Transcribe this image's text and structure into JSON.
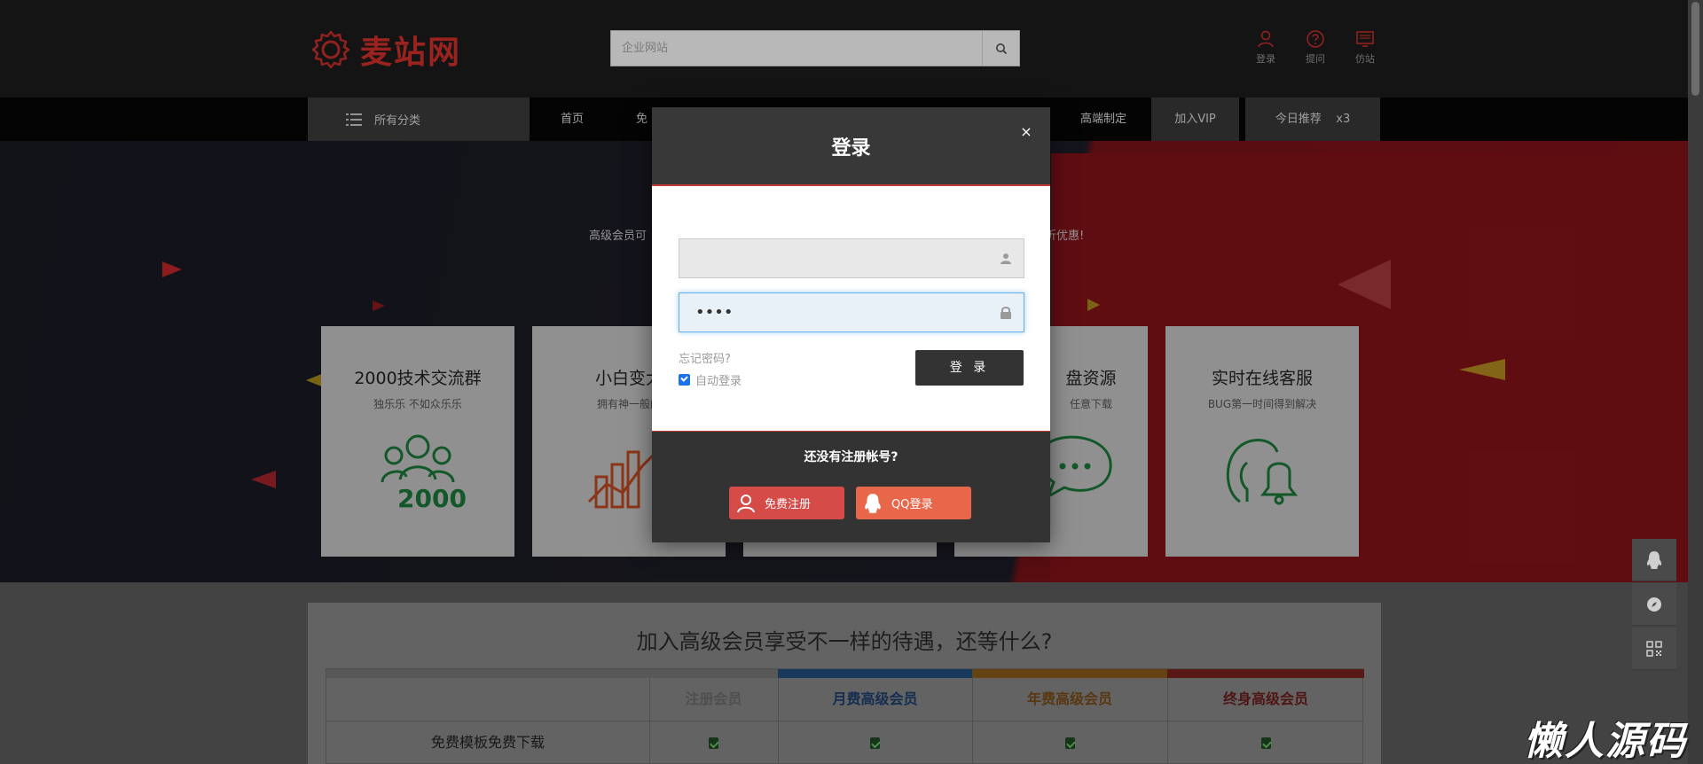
{
  "brand": {
    "name": "麦站网",
    "color": "#d6312d"
  },
  "search": {
    "placeholder": "企业网站"
  },
  "top_links": [
    {
      "label": "登录",
      "icon": "user-icon"
    },
    {
      "label": "提问",
      "icon": "question-icon"
    },
    {
      "label": "仿站",
      "icon": "monitor-icon"
    }
  ],
  "nav": {
    "categories_label": "所有分类",
    "items": [
      "首页",
      "免",
      "高端制定"
    ],
    "vip_label": "加入VIP",
    "today_label": "今日推荐",
    "today_count": "x3"
  },
  "banner": {
    "text_left": "高级会员可",
    "text_right": "折优惠!"
  },
  "cards": [
    {
      "title": "2000技术交流群",
      "subtitle": "独乐乐 不如众乐乐",
      "icon": "group-2000-icon"
    },
    {
      "title": "小白变大",
      "subtitle": "拥有神一般的",
      "icon": "chart-growth-icon"
    },
    {
      "title": "",
      "subtitle": "",
      "icon": ""
    },
    {
      "title": "盘资源",
      "subtitle": "任意下载",
      "icon": "chat-bubble-icon"
    },
    {
      "title": "实时在线客服",
      "subtitle": "BUG第一时间得到解决",
      "icon": "support-bell-icon"
    }
  ],
  "pricing": {
    "title": "加入高级会员享受不一样的待遇，还等什么?",
    "columns": [
      {
        "label": "注册会员",
        "color": "#6e6e6e",
        "bar": "#7a7a7a"
      },
      {
        "label": "月费高级会员",
        "color": "#1d3f70",
        "bar": "#21507f"
      },
      {
        "label": "年费高级会员",
        "color": "#7a4d1a",
        "bar": "#8c5d1c"
      },
      {
        "label": "终身高级会员",
        "color": "#6e1e1e",
        "bar": "#7a2222"
      }
    ],
    "rows": [
      {
        "feature": "免费模板免费下载"
      }
    ]
  },
  "modal": {
    "title": "登录",
    "close": "×",
    "username_value": "",
    "password_value": "••••",
    "forgot": "忘记密码?",
    "auto_login": "自动登录",
    "submit": "登 录",
    "no_account": "还没有注册帐号?",
    "register": "免费注册",
    "qq_login": "QQ登录",
    "register_color": "#d44b48",
    "qq_color": "#e8674a"
  },
  "watermark": "懒人源码"
}
